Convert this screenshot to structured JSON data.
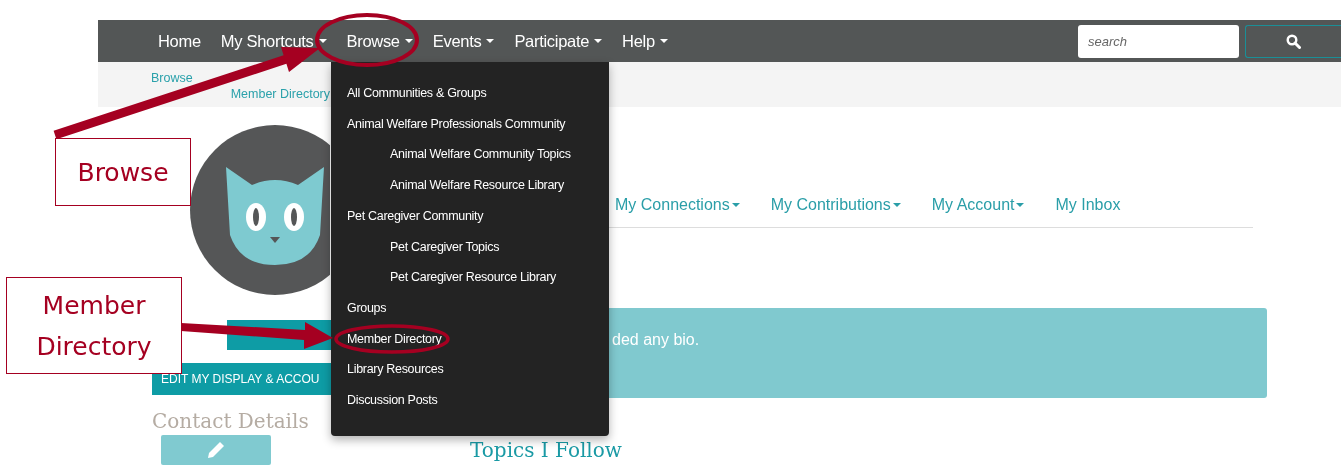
{
  "navbar": {
    "items": [
      {
        "label": "Home",
        "dropdown": false
      },
      {
        "label": "My Shortcuts",
        "dropdown": true
      },
      {
        "label": "Browse",
        "dropdown": true
      },
      {
        "label": "Events",
        "dropdown": true
      },
      {
        "label": "Participate",
        "dropdown": true
      },
      {
        "label": "Help",
        "dropdown": true
      }
    ],
    "search": {
      "placeholder": "search"
    }
  },
  "breadcrumb": [
    "Browse",
    "Member Directory"
  ],
  "browse_menu": [
    {
      "label": "All Communities & Groups"
    },
    {
      "label": "Animal Welfare Professionals Community",
      "children": [
        {
          "label": "Animal Welfare Community Topics"
        },
        {
          "label": "Animal Welfare Resource Library"
        }
      ]
    },
    {
      "label": "Pet Caregiver Community",
      "children": [
        {
          "label": "Pet Caregiver Topics"
        },
        {
          "label": "Pet Caregiver Resource Library"
        }
      ]
    },
    {
      "label": "Groups"
    },
    {
      "label": "Member Directory"
    },
    {
      "label": "Library Resources"
    },
    {
      "label": "Discussion Posts"
    }
  ],
  "profile": {
    "edit_button": "EDIT MY DISPLAY & ACCOU",
    "contact_heading": "Contact Details"
  },
  "tabs": [
    {
      "label": "My Connections",
      "dropdown": true
    },
    {
      "label": "My Contributions",
      "dropdown": true
    },
    {
      "label": "My Account",
      "dropdown": true
    },
    {
      "label": "My Inbox",
      "dropdown": false
    }
  ],
  "bio_notice": "ded any bio.",
  "topics_heading": "Topics I Follow",
  "annotations": [
    {
      "kind": "callout",
      "text": "Browse"
    },
    {
      "kind": "callout",
      "text": "Member Directory"
    }
  ]
}
